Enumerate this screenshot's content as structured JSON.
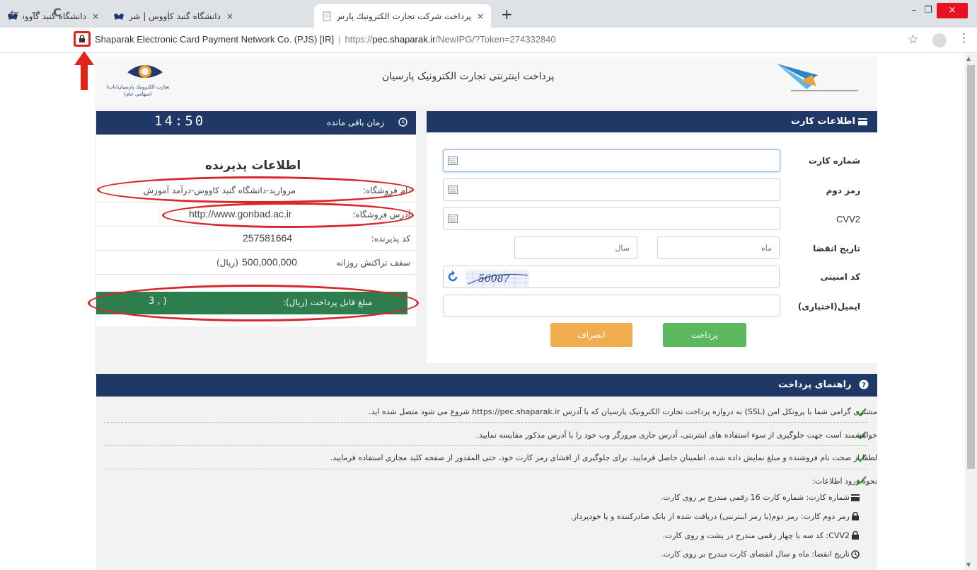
{
  "browser": {
    "tabs": [
      {
        "title": "دانشگاه گنبد کاووس | شرکت سامان"
      },
      {
        "title": "دانشگاه گنبد کاووس | شرکت سامان"
      },
      {
        "title": "پرداخت شرکت تجارت الكترونيك پارس"
      }
    ],
    "close_glyph": "×",
    "new_tab": "+",
    "address": {
      "cert_name": "Shaparak Electronic Card Payment Network Co. (PJS) [IR]",
      "separator": "|",
      "scheme": "https://",
      "host": "pec.shaparak.ir",
      "path": "/NewIPG/?Token=274332840"
    },
    "icons": {
      "back": "←",
      "forward": "→",
      "reload": "C",
      "star": "☆",
      "menu": "⋮",
      "minimize": "–",
      "maximize": "❐",
      "close": "×"
    }
  },
  "header": {
    "title": "پرداخت اینترنتی تجارت الکترونیک پارسیان",
    "left_logo_line1": "تجارت الكترونيك پارسيان(تاپ)",
    "left_logo_line2": "(سهامی عام)"
  },
  "timer": {
    "label": "زمان باقی مانده",
    "value": "14:50"
  },
  "merchant": {
    "title": "اطلاعات پذیرنده",
    "rows": [
      {
        "label": "نام فروشگاه:",
        "value": "مروارید-دانشگاه گنبد کاووس-درآمد آموزش"
      },
      {
        "label": "آدرس فروشگاه:",
        "value": "http://www.gonbad.ac.ir"
      },
      {
        "label": "کد پذیرنده:",
        "value": "257581664"
      },
      {
        "label": "سقف تراکنش روزانه",
        "value": "500,000,000",
        "unit": "(ریال)"
      }
    ],
    "amount_label": "مبلغ قابل پرداخت (ریال):",
    "amount_value": "3  ,  )"
  },
  "card": {
    "title": "اطلاعات کارت",
    "fields": {
      "card_number": "شماره کارت",
      "pin2": "رمز دوم",
      "cvv2": "CVV2",
      "expiry": "تاریخ انقضا",
      "captcha": "کد امنیتی",
      "email": "ایمیل(اختیاری)"
    },
    "month_placeholder": "ماه",
    "year_placeholder": "سال",
    "captcha_text": "56087",
    "pay_button": "پرداخت",
    "cancel_button": "انصراف"
  },
  "help": {
    "title": "راهنمای پرداخت",
    "lines": [
      "مشتری گرامی شما با پروتکل امن (SSL) به دروازه پرداخت تجارت الکترونیک پارسیان که با آدرس https://pec.shaparak.ir شروع می شود متصل شده اید.",
      "خواهشمند است جهت جلوگیری از سوء استفاده های اینترنتی، آدرس جاری مرورگر وب خود را با آدرس مذکور مقایسه نمایید.",
      "لطفا از صحت نام فروشنده و مبلغ نمایش داده شده، اطمینان حاصل فرمایید. برای جلوگیری از افشای رمز کارت خود، حتی المقدور از صفحه کلید مجازی استفاده فرمایید.",
      "نحوه ورود اطلاعات:"
    ],
    "sub_lines": [
      "شماره کارت: شماره کارت 16 رقمی مندرج بر روی کارت.",
      "رمز دوم کارت: رمز دوم(یا رمز اینترنتی) دریافت شده از بانک صادرکننده و یا خودپرداز.",
      "CVV2: کد سه یا چهار رقمی مندرج در پشت و روی کارت.",
      "تاریخ انقضا: ماه و سال انقضای کارت مندرج بر روی کارت."
    ]
  },
  "colors": {
    "navy": "#1f3866",
    "green": "#2e7d4f",
    "pay_green": "#5cb85c",
    "cancel_orange": "#f0ad4e",
    "annotation_red": "#d9262b"
  }
}
